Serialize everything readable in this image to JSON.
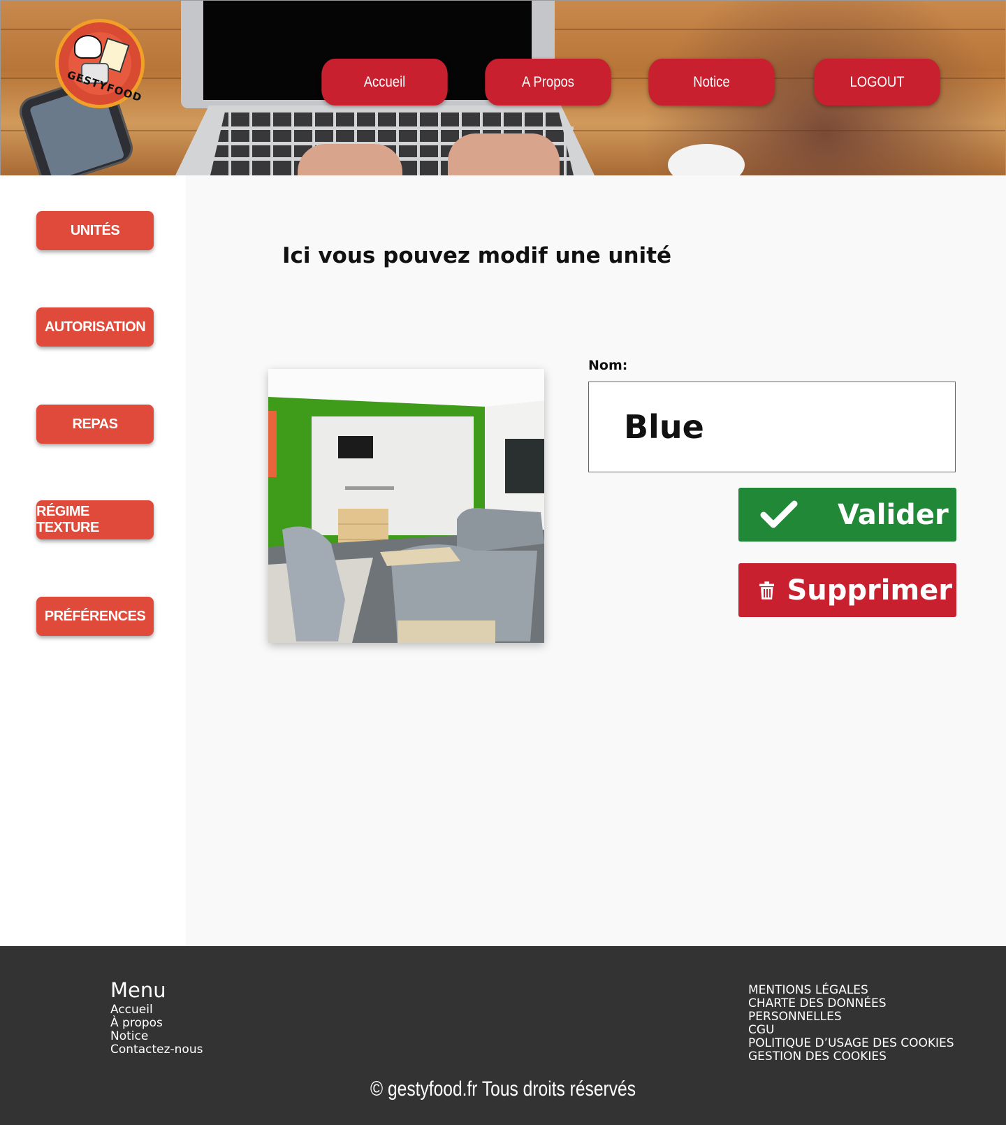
{
  "header": {
    "logo_text": "GESTYFOOD",
    "nav": [
      {
        "label": "Accueil"
      },
      {
        "label": "A Propos"
      },
      {
        "label": "Notice"
      },
      {
        "label": "LOGOUT"
      }
    ]
  },
  "sidebar": {
    "items": [
      {
        "label": "UNITÉS"
      },
      {
        "label": "AUTORISATION"
      },
      {
        "label": "REPAS"
      },
      {
        "label": "RÉGIME TEXTURE"
      },
      {
        "label": "PRÉFÉRENCES"
      }
    ]
  },
  "main": {
    "title": "Ici vous pouvez modif une unité",
    "name_label": "Nom:",
    "name_value": "Blue",
    "validate_label": "Valider",
    "delete_label": "Supprimer"
  },
  "footer": {
    "menu_title": "Menu",
    "menu_links": [
      "Accueil",
      "À propos",
      "Notice",
      "Contactez-nous"
    ],
    "legal_links": [
      "MENTIONS LÉGALES",
      "CHARTE DES DONNÉES",
      "PERSONNELLES",
      "CGU",
      "POLITIQUE D’USAGE DES COOKIES",
      "GESTION DES COOKIES"
    ],
    "copyright": "© gestyfood.fr  Tous droits réservés"
  },
  "colors": {
    "nav_red": "#c8202f",
    "sidebar_red": "#e04a3a",
    "validate_green": "#218838",
    "delete_red": "#c8202f",
    "footer_bg": "#333333"
  },
  "icons": {
    "validate": "check-icon",
    "delete": "trash-icon"
  }
}
